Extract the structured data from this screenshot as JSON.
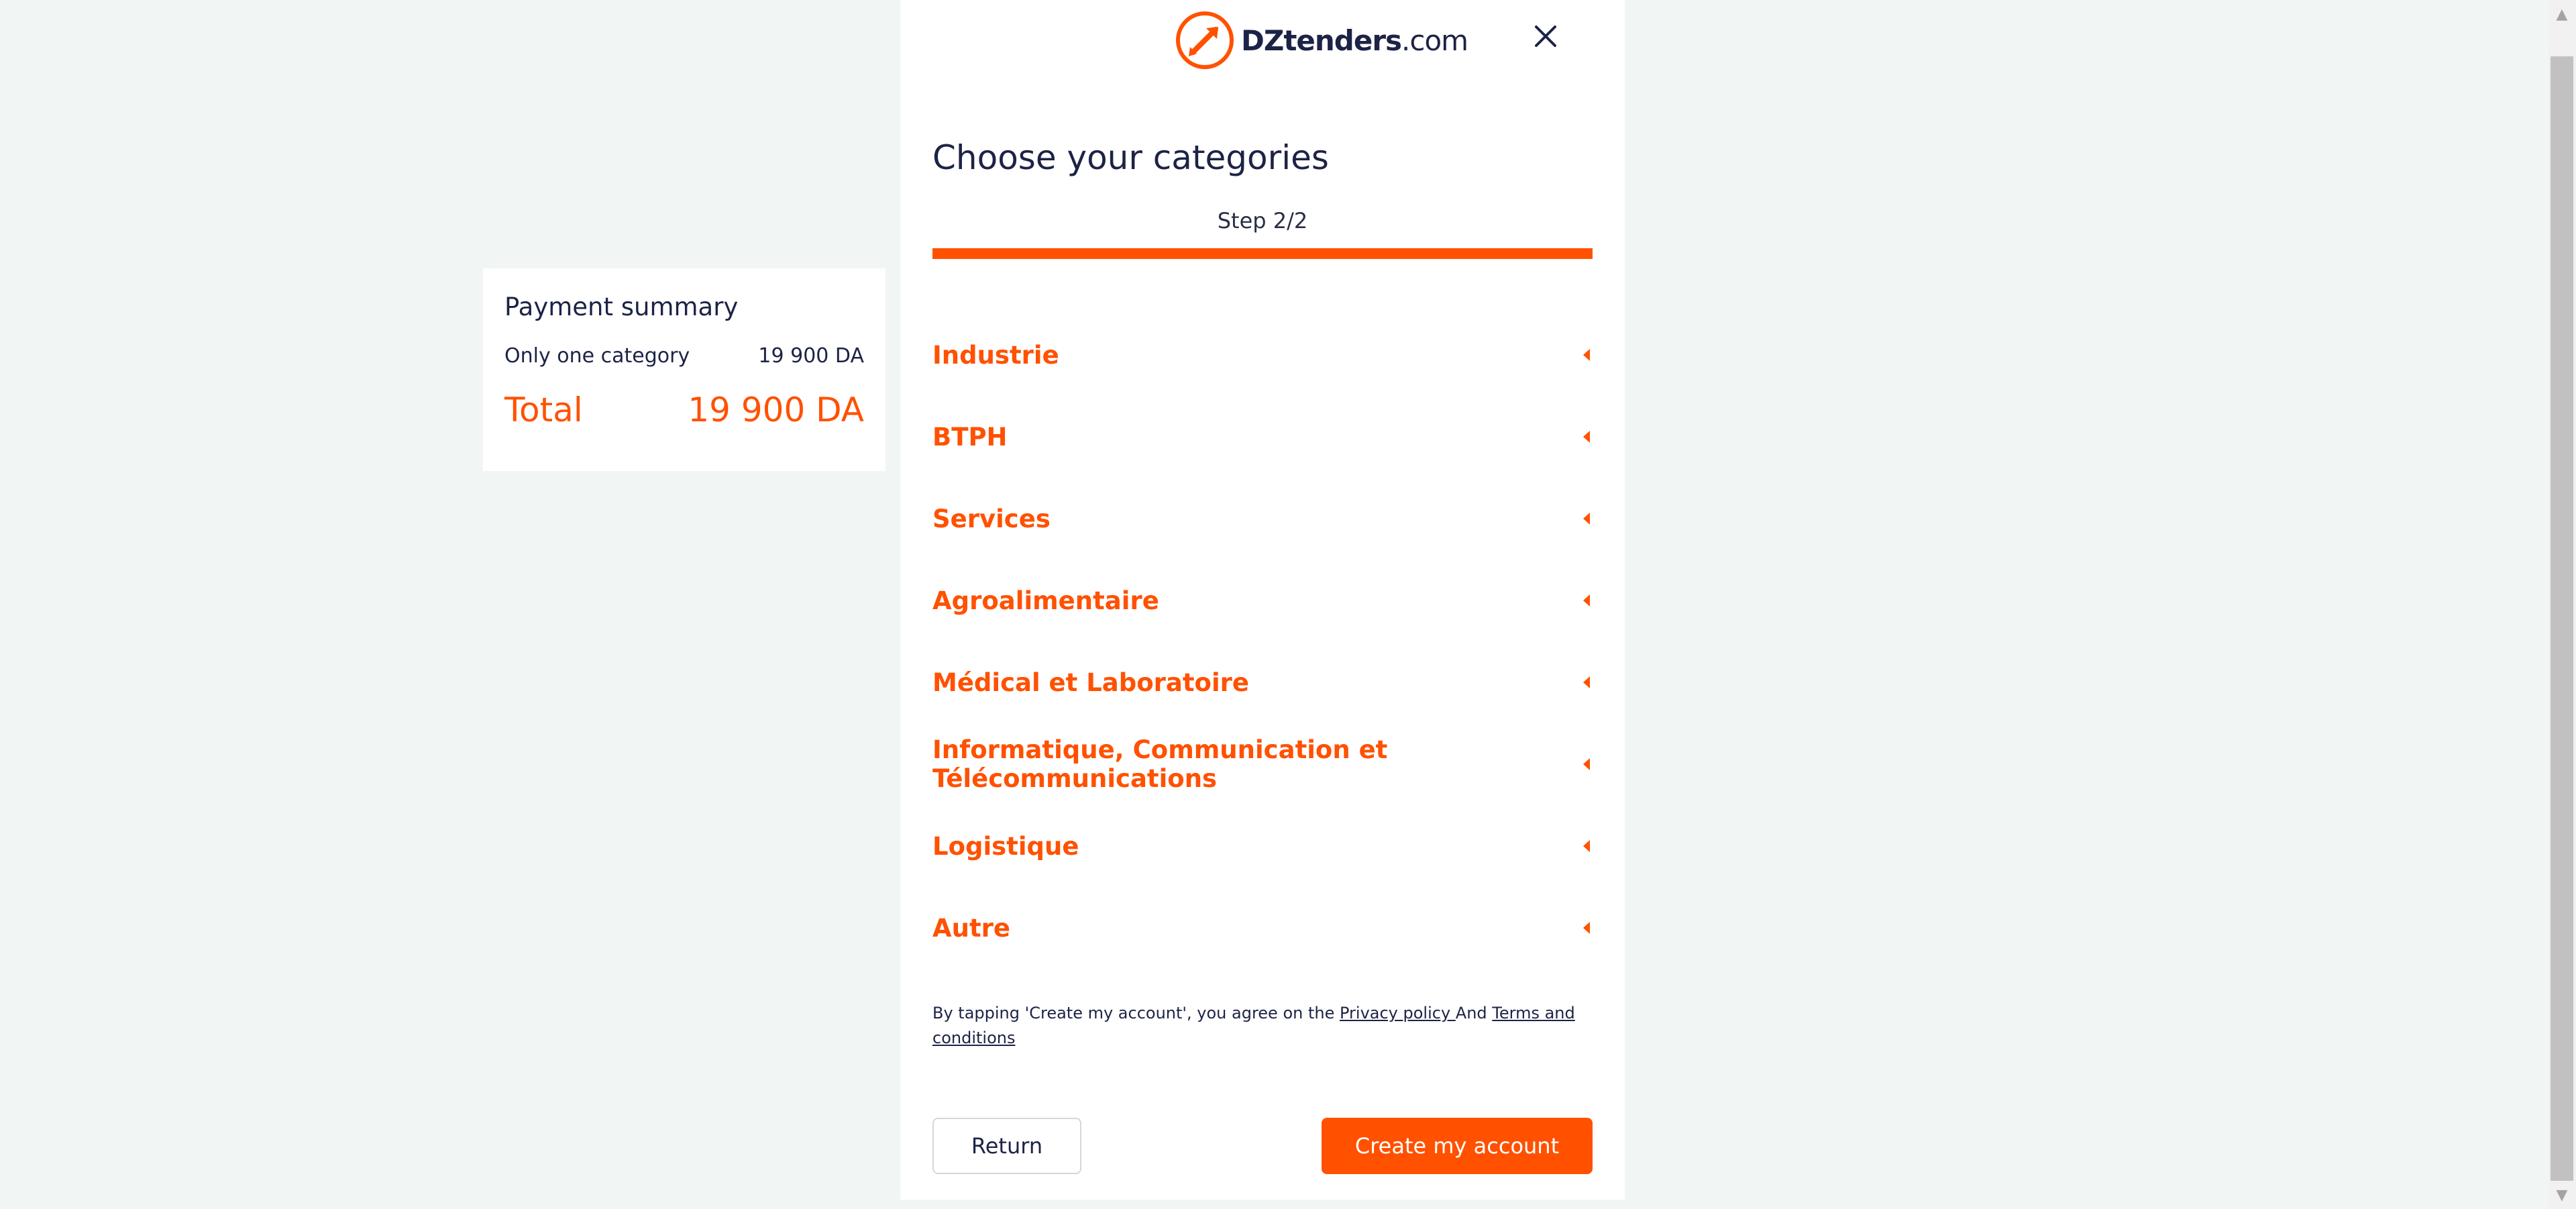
{
  "summary": {
    "title": "Payment summary",
    "item_label": "Only one category",
    "item_price": "19 900 DA",
    "total_label": "Total",
    "total_price": "19 900 DA"
  },
  "brand": {
    "name_bold": "DZtenders",
    "name_suffix": ".com",
    "accent_color": "#ff5100",
    "text_color": "#1c2346"
  },
  "modal": {
    "heading": "Choose your categories",
    "step": "Step 2/2",
    "progress_fraction": 1.0
  },
  "categories": [
    {
      "label": "Industrie"
    },
    {
      "label": "BTPH"
    },
    {
      "label": "Services"
    },
    {
      "label": "Agroalimentaire"
    },
    {
      "label": "Médical et Laboratoire"
    },
    {
      "label": "Informatique, Communication et Télécommunications"
    },
    {
      "label": "Logistique"
    },
    {
      "label": "Autre"
    }
  ],
  "legal": {
    "prefix": "By tapping 'Create my account', you agree on the ",
    "privacy_link": "Privacy policy ",
    "conjunction": "And ",
    "terms_link": "Terms and conditions"
  },
  "actions": {
    "return_label": "Return",
    "create_label": "Create my account"
  },
  "icons": {
    "close": "close-icon",
    "caret": "caret-left-icon",
    "logo": "rocket-logo-icon"
  }
}
